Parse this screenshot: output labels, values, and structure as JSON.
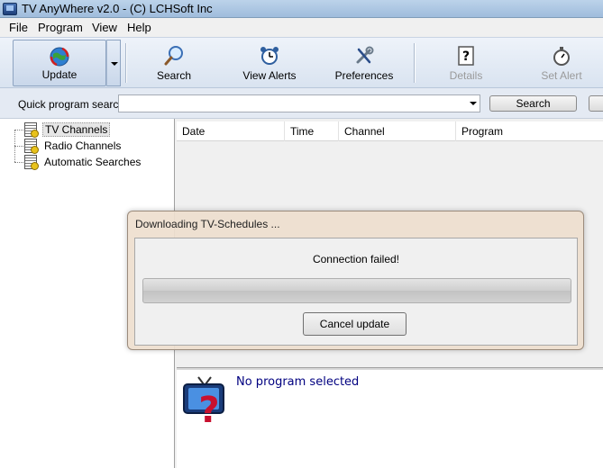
{
  "window": {
    "title": "TV AnyWhere v2.0 - (C) LCHSoft Inc"
  },
  "menu": {
    "items": [
      "File",
      "Program",
      "View",
      "Help"
    ]
  },
  "toolbar": {
    "update": "Update",
    "search": "Search",
    "view_alerts": "View Alerts",
    "preferences": "Preferences",
    "details": "Details",
    "set_alert": "Set Alert"
  },
  "quick_search": {
    "label": "Quick program search",
    "value": "",
    "button": "Search"
  },
  "tree": {
    "items": [
      "TV Channels",
      "Radio Channels",
      "Automatic Searches"
    ],
    "selected": "TV Channels"
  },
  "list": {
    "columns": [
      "Date",
      "Time",
      "Channel",
      "Program"
    ]
  },
  "info": {
    "message": "No program selected"
  },
  "dialog": {
    "title": "Downloading TV-Schedules ...",
    "message": "Connection failed!",
    "progress": 0,
    "cancel": "Cancel update"
  },
  "colors": {
    "dialog_bg": "#eedece",
    "info_text": "#000080",
    "toolbar_bg": "#d9e3f0"
  },
  "icons": {
    "update": "globe-refresh-icon",
    "search": "magnifier-icon",
    "view_alerts": "alarm-clock-icon",
    "preferences": "wrench-screwdriver-icon",
    "details": "question-document-icon",
    "set_alert": "stopwatch-icon",
    "tree": "document-icon",
    "info": "tv-question-icon"
  }
}
